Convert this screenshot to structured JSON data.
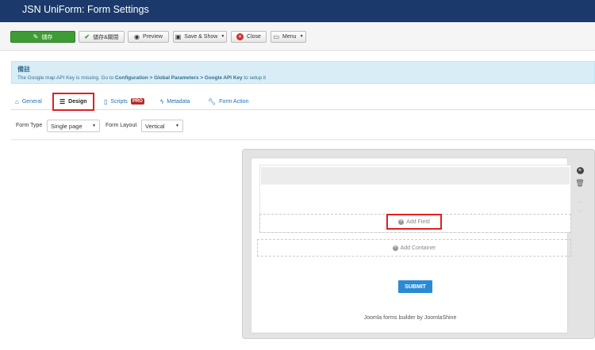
{
  "header": {
    "title": "JSN UniForm: Form Settings"
  },
  "toolbar": {
    "save_label": "儲存",
    "save_close_label": "儲存&關閉",
    "preview_label": "Preview",
    "save_show_label": "Save & Show",
    "close_label": "Close",
    "menu_label": "Menu"
  },
  "alert": {
    "title": "備註",
    "msg_prefix": "The Google map API Key is missing. Go to",
    "link_config": "Configuration",
    "sep1": ">",
    "link_global": "Global Parameters",
    "sep2": ">",
    "link_key": "Google API Key",
    "msg_suffix": "to setup it"
  },
  "tabs": [
    {
      "label": "General",
      "icon": "home-icon"
    },
    {
      "label": "Design",
      "icon": "list-icon"
    },
    {
      "label": "Scripts",
      "icon": "file-icon",
      "badge": "PRO"
    },
    {
      "label": "Metadata",
      "icon": "bolt-icon"
    },
    {
      "label": "Form Action",
      "icon": "wrench-icon"
    }
  ],
  "options": {
    "form_type_label": "Form Type",
    "form_type_value": "Single page",
    "form_layout_label": "Form Layout",
    "form_layout_value": "Vertical"
  },
  "canvas": {
    "add_field_label": "Add Field",
    "add_container_label": "Add Container",
    "submit_label": "SUBMIT",
    "footer_text": "Joomla forms builder by JoomlaShine"
  },
  "colors": {
    "header_bg": "#1b3a6b",
    "save_green": "#3f9c35",
    "alert_bg": "#d9edf7",
    "highlight_red": "#e02020",
    "submit_blue": "#2a8ad4"
  }
}
